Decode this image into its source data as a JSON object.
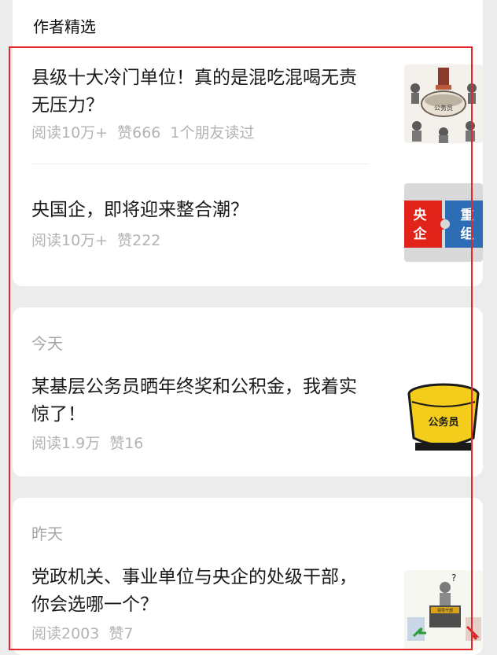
{
  "section_title": "作者精选",
  "colors": {
    "accent_box": "#e5262d",
    "meta_text": "#b3b3b3",
    "background": "#ececec"
  },
  "featured": [
    {
      "title": "县级十大冷门单位！真的是混吃混喝无责无压力？",
      "reads": "阅读10万+",
      "likes": "赞666",
      "friends": "1个朋友读过",
      "thumb": "civil-servant-cartoon-icon"
    },
    {
      "title": "央国企，即将迎来整合潮？",
      "reads": "阅读10万+",
      "likes": "赞222",
      "thumb": "puzzle-restructure-icon",
      "thumb_text": {
        "left_top": "央",
        "left_bottom": "企",
        "right_top": "重",
        "right_bottom": "组"
      }
    }
  ],
  "today": {
    "date": "今天",
    "article": {
      "title": "某基层公务员晒年终奖和公积金，我着实惊了！",
      "reads": "阅读1.9万",
      "likes": "赞16",
      "thumb": "iron-rice-bowl-icon",
      "thumb_text": "公务员"
    }
  },
  "yesterday": {
    "date": "昨天",
    "article": {
      "title": "党政机关、事业单位与央企的处级干部，你会选哪一个？",
      "reads": "阅读2003",
      "likes": "赞7",
      "thumb": "cadre-podium-icon",
      "thumb_text": "领导干部"
    }
  }
}
